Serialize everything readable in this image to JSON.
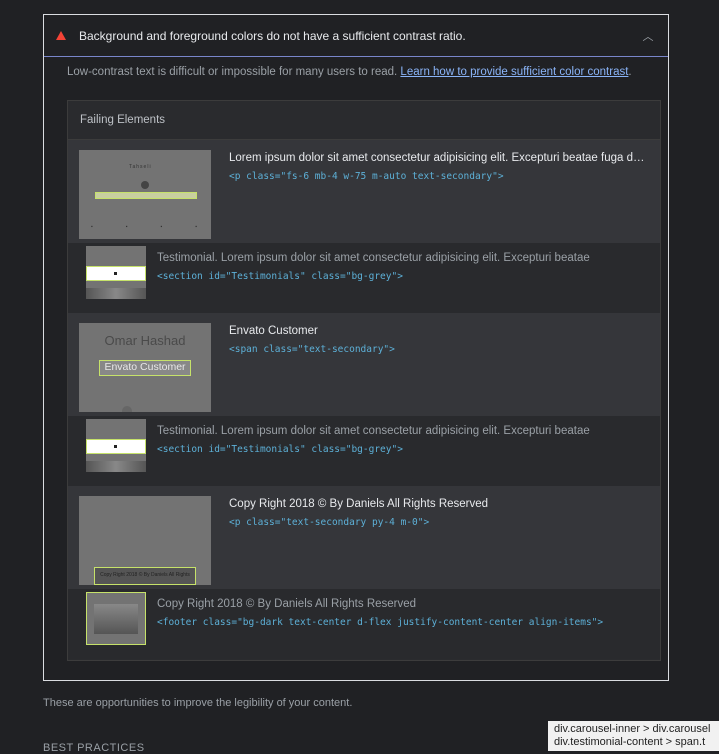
{
  "audit": {
    "title": "Background and foreground colors do not have a sufficient contrast ratio.",
    "description_prefix": "Low-contrast text is difficult or impossible for many users to read. ",
    "description_link": "Learn how to provide sufficient color contrast",
    "description_suffix": ".",
    "status_color": "#f44336",
    "expanded": true
  },
  "table": {
    "header": "Failing Elements",
    "rows": [
      {
        "label": "Lorem ipsum dolor sit amet consectetur adipisicing elit. Excepturi beatae fuga dolore",
        "code": "<p class=\"fs-6 mb-4 w-75 m-auto text-secondary\">"
      },
      {
        "label": "Testimonial. Lorem ipsum dolor sit amet consectetur adipisicing elit. Excepturi beatae",
        "code": "<section id=\"Testimonials\" class=\"bg-grey\">"
      },
      {
        "label": "Envato Customer",
        "code": "<span class=\"text-secondary\">",
        "thumb_name": "Omar Hashad",
        "thumb_box": "Envato Customer"
      },
      {
        "label": "Testimonial. Lorem ipsum dolor sit amet consectetur adipisicing elit. Excepturi beatae",
        "code": "<section id=\"Testimonials\" class=\"bg-grey\">"
      },
      {
        "label": "Copy Right 2018 © By Daniels All Rights Reserved",
        "code": "<p class=\"text-secondary py-4 m-0\">",
        "thumb_box": "Copy Right 2018 © By Daniels All Rights Reserved"
      },
      {
        "label": "Copy Right 2018 © By Daniels All Rights Reserved",
        "code": "<footer class=\"bg-dark text-center d-flex justify-content-center align-items\">"
      }
    ]
  },
  "thumb1": {
    "title": "Tahseli"
  },
  "footer_note": "These are opportunities to improve the legibility of your content.",
  "section_best": "BEST PRACTICES",
  "tooltip": {
    "line1": "div.carousel-inner > div.carousel",
    "line2": "div.testimonial-content > span.t"
  }
}
